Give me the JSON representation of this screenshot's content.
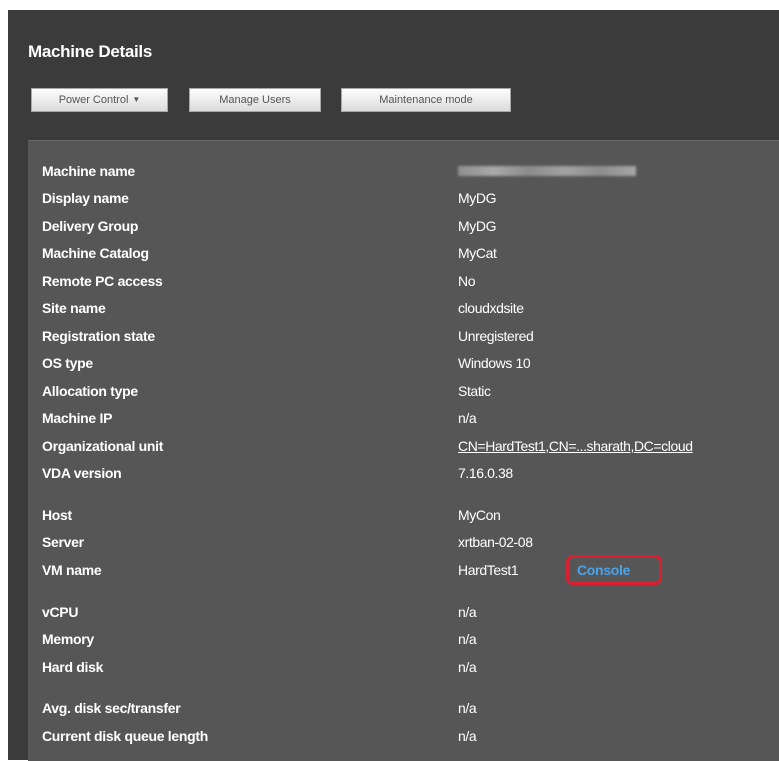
{
  "title": "Machine Details",
  "toolbar": {
    "power_control": "Power Control",
    "manage_users": "Manage Users",
    "maintenance_mode": "Maintenance mode"
  },
  "details": {
    "machine_name": {
      "label": "Machine name",
      "value": ""
    },
    "display_name": {
      "label": "Display name",
      "value": "MyDG"
    },
    "delivery_group": {
      "label": "Delivery Group",
      "value": "MyDG"
    },
    "machine_catalog": {
      "label": "Machine Catalog",
      "value": "MyCat"
    },
    "remote_pc_access": {
      "label": "Remote PC access",
      "value": "No"
    },
    "site_name": {
      "label": "Site name",
      "value": "cloudxdsite"
    },
    "registration_state": {
      "label": "Registration state",
      "value": "Unregistered"
    },
    "os_type": {
      "label": "OS type",
      "value": "Windows 10"
    },
    "allocation_type": {
      "label": "Allocation type",
      "value": "Static"
    },
    "machine_ip": {
      "label": "Machine IP",
      "value": "n/a"
    },
    "organizational_unit": {
      "label": "Organizational unit",
      "value": "CN=HardTest1,CN=...sharath,DC=cloud"
    },
    "vda_version": {
      "label": "VDA version",
      "value": "7.16.0.38"
    },
    "host": {
      "label": "Host",
      "value": "MyCon"
    },
    "server": {
      "label": "Server",
      "value": "xrtban-02-08"
    },
    "vm_name": {
      "label": "VM name",
      "value": "HardTest1",
      "console": "Console"
    },
    "vcpu": {
      "label": "vCPU",
      "value": "n/a"
    },
    "memory": {
      "label": "Memory",
      "value": "n/a"
    },
    "hard_disk": {
      "label": "Hard disk",
      "value": "n/a"
    },
    "avg_disk": {
      "label": "Avg. disk sec/transfer",
      "value": "n/a"
    },
    "disk_queue": {
      "label": "Current disk queue length",
      "value": "n/a"
    }
  },
  "colors": {
    "background": "#3b3b3b",
    "panel": "#565656",
    "highlight": "#d9202e",
    "link": "#4ba3ea"
  }
}
